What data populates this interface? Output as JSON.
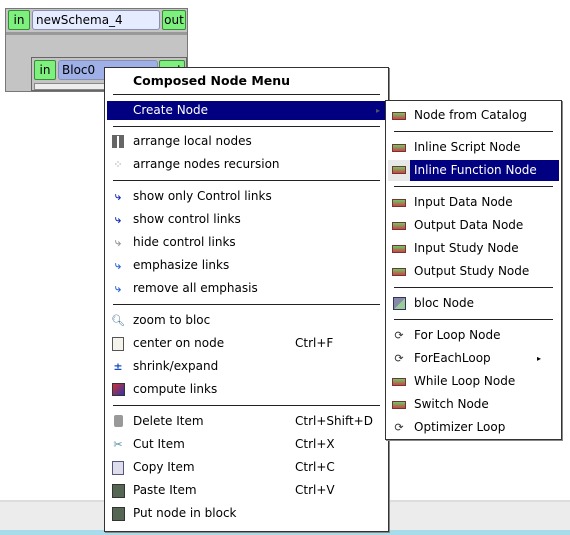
{
  "schema": {
    "in": "in",
    "name": "newSchema_4",
    "out": "out",
    "bloc": {
      "in": "in",
      "name": "Bloc0",
      "out": "out"
    }
  },
  "menu": {
    "title": "Composed Node Menu",
    "create_node": "Create Node",
    "groups": [
      [
        {
          "label": "arrange local nodes",
          "icon": "arrange-grid-icon"
        },
        {
          "label": "arrange nodes recursion",
          "icon": "arrange-tree-icon"
        }
      ],
      [
        {
          "label": "show only Control links",
          "icon": "control-link-icon"
        },
        {
          "label": "show control links",
          "icon": "control-link-icon"
        },
        {
          "label": "hide control links",
          "icon": "control-link-gray-icon"
        },
        {
          "label": "emphasize links",
          "icon": "link-emphasis-icon"
        },
        {
          "label": "remove all emphasis",
          "icon": "link-emphasis-icon"
        }
      ],
      [
        {
          "label": "zoom to bloc",
          "icon": "magnifier-icon"
        },
        {
          "label": "center on node",
          "shortcut": "Ctrl+F",
          "icon": "page-icon"
        },
        {
          "label": "shrink/expand",
          "icon": "plus-minus-icon"
        },
        {
          "label": "compute links",
          "icon": "compute-links-icon"
        }
      ],
      [
        {
          "label": "Delete Item",
          "shortcut": "Ctrl+Shift+D",
          "icon": "trash-icon"
        },
        {
          "label": "Cut Item",
          "shortcut": "Ctrl+X",
          "icon": "scissors-icon"
        },
        {
          "label": "Copy Item",
          "shortcut": "Ctrl+C",
          "icon": "copy-icon"
        },
        {
          "label": "Paste Item",
          "shortcut": "Ctrl+V",
          "icon": "paste-icon"
        },
        {
          "label": "Put node in block",
          "icon": "paste-icon"
        }
      ]
    ]
  },
  "submenu": {
    "groups": [
      [
        {
          "label": "Node from Catalog",
          "icon": "node-icon"
        }
      ],
      [
        {
          "label": "Inline Script Node",
          "icon": "node-icon"
        },
        {
          "label": "Inline Function Node",
          "icon": "node-icon",
          "highlighted": true
        }
      ],
      [
        {
          "label": "Input Data Node",
          "icon": "node-icon"
        },
        {
          "label": "Output Data Node",
          "icon": "node-icon"
        },
        {
          "label": "Input Study Node",
          "icon": "node-icon"
        },
        {
          "label": "Output Study Node",
          "icon": "node-icon"
        }
      ],
      [
        {
          "label": "bloc Node",
          "icon": "bloc-icon"
        }
      ],
      [
        {
          "label": "For Loop Node",
          "icon": "loop-icon"
        },
        {
          "label": "ForEachLoop",
          "icon": "loop-icon",
          "submenu": true
        },
        {
          "label": "While Loop Node",
          "icon": "node-icon"
        },
        {
          "label": "Switch Node",
          "icon": "switch-icon"
        },
        {
          "label": "Optimizer Loop",
          "icon": "loop-icon"
        }
      ]
    ]
  },
  "colors": {
    "highlight": "#000080",
    "port": "#7ef07e",
    "node_header": "#e6ecff",
    "bloc_header": "#9fb0e8"
  }
}
